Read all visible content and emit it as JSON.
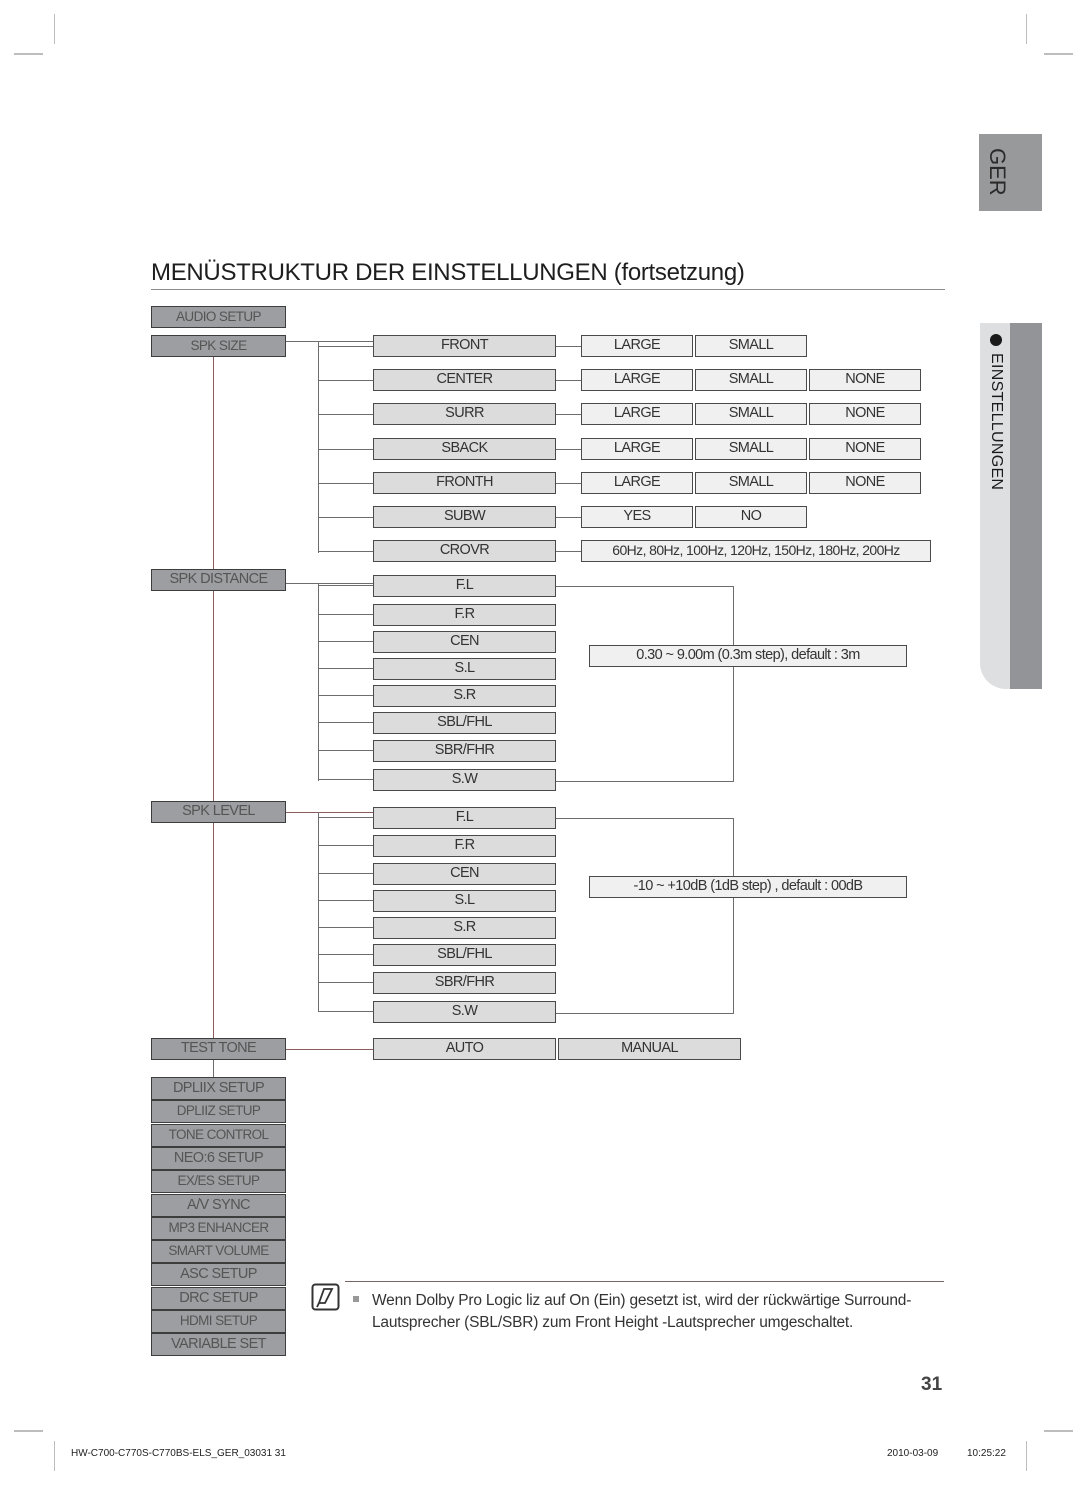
{
  "page": {
    "language_tab": "GER",
    "section_tab": "EINSTELLUNGEN",
    "title": "MENÜSTRUKTUR DER EINSTELLUNGEN (fortsetzung)",
    "page_number": "31",
    "footer": {
      "document_id": "HW-C700-C770S-C770BS-ELS_GER_03031   31",
      "date": "2010-03-09",
      "time": "10:25:22"
    }
  },
  "menu": {
    "audio_setup": "AUDIO SETUP",
    "spk_size": {
      "label": "SPK SIZE",
      "items": [
        {
          "label": "FRONT",
          "options": [
            "LARGE",
            "SMALL"
          ]
        },
        {
          "label": "CENTER",
          "options": [
            "LARGE",
            "SMALL",
            "NONE"
          ]
        },
        {
          "label": "SURR",
          "options": [
            "LARGE",
            "SMALL",
            "NONE"
          ]
        },
        {
          "label": "SBACK",
          "options": [
            "LARGE",
            "SMALL",
            "NONE"
          ]
        },
        {
          "label": "FRONTH",
          "options": [
            "LARGE",
            "SMALL",
            "NONE"
          ]
        },
        {
          "label": "SUBW",
          "options": [
            "YES",
            "NO"
          ]
        },
        {
          "label": "CROVR",
          "options": [
            "60Hz, 80Hz, 100Hz, 120Hz, 150Hz, 180Hz, 200Hz"
          ]
        }
      ]
    },
    "spk_distance": {
      "label": "SPK DISTANCE",
      "items": [
        "F.L",
        "F.R",
        "CEN",
        "S.L",
        "S.R",
        "SBL/FHL",
        "SBR/FHR",
        "S.W"
      ],
      "range": "0.30 ~ 9.00m (0.3m step), default : 3m"
    },
    "spk_level": {
      "label": "SPK LEVEL",
      "items": [
        "F.L",
        "F.R",
        "CEN",
        "S.L",
        "S.R",
        "SBL/FHL",
        "SBR/FHR",
        "S.W"
      ],
      "range": "-10 ~ +10dB (1dB step) , default : 00dB"
    },
    "test_tone": {
      "label": "TEST TONE",
      "options": [
        "AUTO",
        "MANUAL"
      ]
    },
    "other_items": [
      "DPLIIX SETUP",
      "DPLIIZ SETUP",
      "TONE CONTROL",
      "NEO:6 SETUP",
      "EX/ES SETUP",
      "A/V SYNC",
      "MP3 ENHANCER",
      "SMART VOLUME",
      "ASC SETUP",
      "DRC SETUP",
      "HDMI SETUP",
      "VARIABLE SET"
    ]
  },
  "note": {
    "icon": "note-pencil-icon",
    "line1": "Wenn Dolby Pro Logic liz auf On (Ein) gesetzt ist, wird der rückwärtige Surround-",
    "line2": "Lautsprecher (SBL/SBR) zum Front Height -Lautsprecher umgeschaltet."
  }
}
